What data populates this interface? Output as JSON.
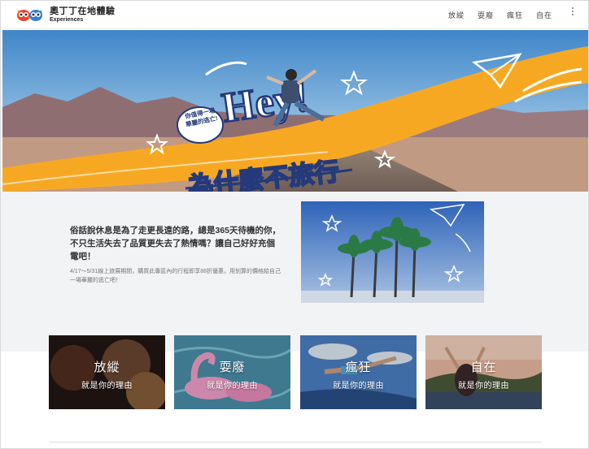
{
  "header": {
    "logo_title": "奧丁丁在地體驗",
    "logo_sub": "Experiences",
    "nav": [
      "放縱",
      "耍廢",
      "瘋狂",
      "自在"
    ]
  },
  "hero": {
    "badge_line1": "你值得一場",
    "badge_line2": "華麗的逃亡!",
    "hey_text": "Hey!",
    "slogan": "為什麼不旅行"
  },
  "intro": {
    "heading": "俗話說休息是為了走更長遠的路，總是365天待機的你，不只生活失去了品質更失去了熱情嗎？讓自己好好充個電吧！",
    "body": "4/17～5/31線上旅展期間，購買此專區內的行程即享88折優惠，用划算的價格給自己一場華麗的逃亡吧！"
  },
  "cards": [
    {
      "title": "放縱",
      "subtitle": "就是你的理由"
    },
    {
      "title": "耍廢",
      "subtitle": "就是你的理由"
    },
    {
      "title": "瘋狂",
      "subtitle": "就是你的理由"
    },
    {
      "title": "自在",
      "subtitle": "就是你的理由"
    }
  ],
  "colors": {
    "accent_orange": "#f7a823",
    "section_bg": "#f2f3f5",
    "nav_text": "#444444"
  }
}
